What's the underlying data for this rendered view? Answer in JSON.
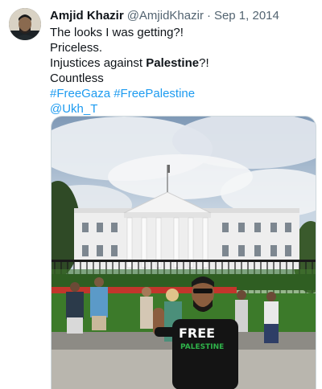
{
  "tweet": {
    "author_name": "Amjid Khazir",
    "author_handle": "@AmjidKhazir",
    "separator": "·",
    "date": "Sep 1, 2014",
    "lines": {
      "l1": "The looks I was getting?!",
      "l2": "Priceless.",
      "l3_before": "Injustices against ",
      "l3_bold": "Palestine",
      "l3_after": "?!",
      "l4": "Countless",
      "hashtag1": "#FreeGaza",
      "hashtag2": "#FreePalestine",
      "mention": "@Ukh_T"
    },
    "photo": {
      "shirt_line1": "FREE",
      "shirt_line2": "PALESTINE"
    }
  },
  "colors": {
    "link": "#1d9bf0",
    "secondary_text": "#536471",
    "primary_text": "#0f1419"
  }
}
